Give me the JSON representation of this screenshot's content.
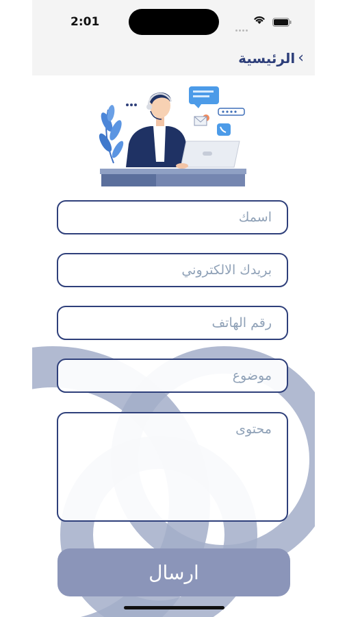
{
  "status_bar": {
    "time": "2:01"
  },
  "nav": {
    "back_label": "الرئيسية"
  },
  "form": {
    "name_placeholder": "اسمك",
    "email_placeholder": "بريدك الالكتروني",
    "phone_placeholder": "رقم الهاتف",
    "subject_placeholder": "موضوع",
    "content_placeholder": "محتوى",
    "submit_label": "ارسال"
  },
  "colors": {
    "primary": "#2e3f7a",
    "button": "#8b95b9",
    "placeholder": "#8fa1b7",
    "rings": "#a3aec9"
  }
}
